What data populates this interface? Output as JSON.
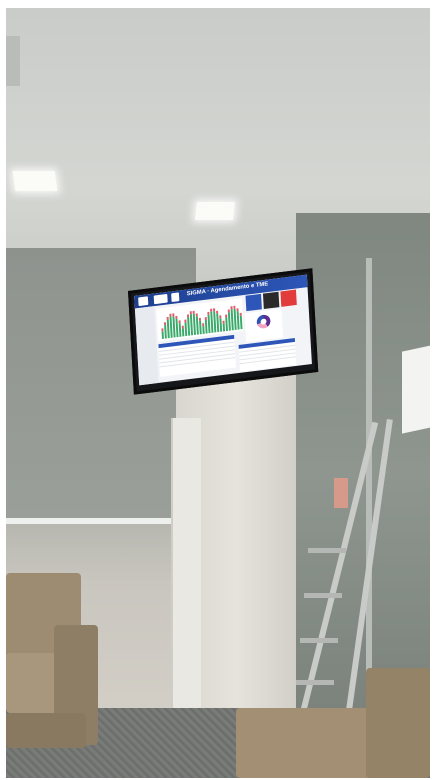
{
  "tv": {
    "title": "SIGMA · Agendamento e TME",
    "colors": {
      "header": "#1d3f8f",
      "kpi_blue": "#2d56b8",
      "kpi_dark": "#2a2a2a",
      "kpi_red": "#e23b3b",
      "bar_green": "#3aaa6a",
      "bar_red": "#e05a6a"
    },
    "icons": [
      "logo-icon",
      "donut-chart-icon"
    ]
  }
}
